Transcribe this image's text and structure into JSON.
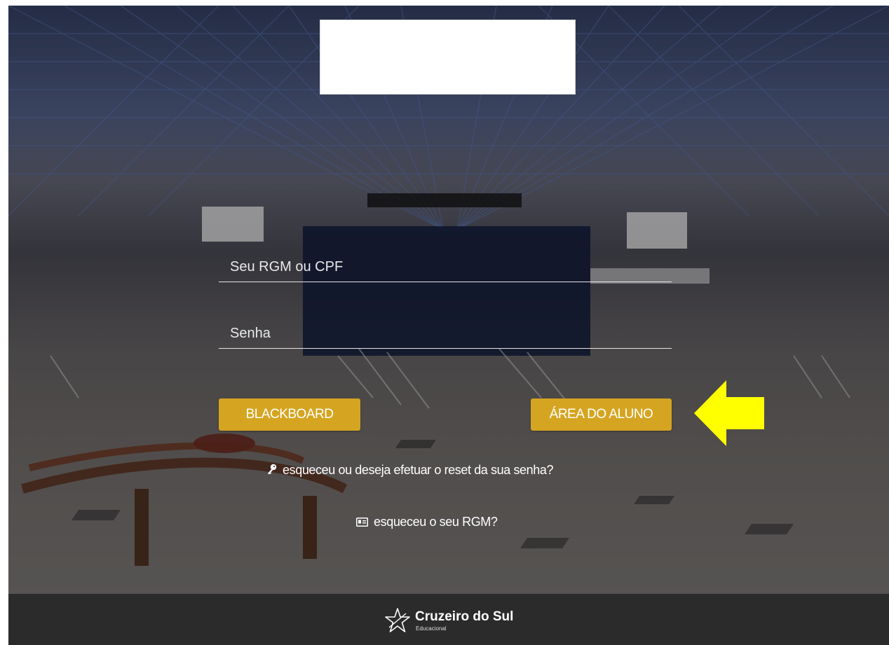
{
  "login": {
    "rgm_placeholder": "Seu RGM ou CPF",
    "password_placeholder": "Senha",
    "blackboard_label": "BLACKBOARD",
    "area_aluno_label": "ÁREA DO ALUNO"
  },
  "links": {
    "reset_password": "esqueceu ou deseja efetuar o reset da sua senha?",
    "forgot_rgm": "esqueceu o seu RGM?"
  },
  "footer": {
    "brand_name": "Cruzeiro do Sul",
    "brand_sub": "Educacional"
  },
  "icons": {
    "reset_icon": "key-icon",
    "rgm_icon": "id-card-icon",
    "brand_icon": "star-logo-icon",
    "annotation": "arrow-left-icon"
  },
  "colors": {
    "button": "#d5a521",
    "arrow": "#ffff00",
    "footer": "#2b2b2b"
  }
}
